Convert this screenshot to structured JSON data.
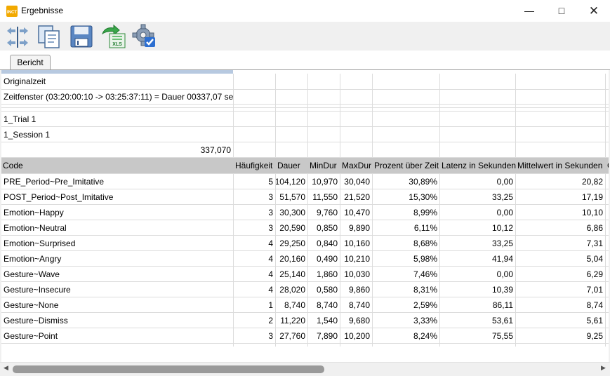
{
  "window": {
    "title": "Ergebnisse",
    "icon_text": "INCT"
  },
  "toolbar": {
    "buttons": [
      "transfer-icon",
      "copy-icon",
      "save-icon",
      "export-xls-icon",
      "settings-icon"
    ],
    "xls_label": "XLS"
  },
  "tabs": [
    {
      "label": "Bericht",
      "active": true
    }
  ],
  "report": {
    "info_rows": [
      "Originalzeit",
      "Zeitfenster  (03:20:00:10 -> 03:25:37:11) = Dauer 00337,07 sec",
      "1_Trial 1",
      "1_Session 1"
    ],
    "total": "337,070",
    "columns": [
      "Code",
      "Häufigkeit",
      "Dauer",
      "MinDur",
      "MaxDur",
      "Prozent über Zeit",
      "Latenz in Sekunden",
      "Mittelwert in Sekunden",
      "C"
    ],
    "rows": [
      [
        "PRE_Period~Pre_Imitative",
        "5",
        "104,120",
        "10,970",
        "30,040",
        "30,89%",
        "0,00",
        "20,82"
      ],
      [
        "POST_Period~Post_Imitative",
        "3",
        "51,570",
        "11,550",
        "21,520",
        "15,30%",
        "33,25",
        "17,19"
      ],
      [
        "Emotion~Happy",
        "3",
        "30,300",
        "9,760",
        "10,470",
        "8,99%",
        "0,00",
        "10,10"
      ],
      [
        "Emotion~Neutral",
        "3",
        "20,590",
        "0,850",
        "9,890",
        "6,11%",
        "10,12",
        "6,86"
      ],
      [
        "Emotion~Surprised",
        "4",
        "29,250",
        "0,840",
        "10,160",
        "8,68%",
        "33,25",
        "7,31"
      ],
      [
        "Emotion~Angry",
        "4",
        "20,160",
        "0,490",
        "10,210",
        "5,98%",
        "41,94",
        "5,04"
      ],
      [
        "Gesture~Wave",
        "4",
        "25,140",
        "1,860",
        "10,030",
        "7,46%",
        "0,00",
        "6,29"
      ],
      [
        "Gesture~Insecure",
        "4",
        "28,020",
        "0,580",
        "9,860",
        "8,31%",
        "10,39",
        "7,01"
      ],
      [
        "Gesture~None",
        "1",
        "8,740",
        "8,740",
        "8,740",
        "2,59%",
        "86,11",
        "8,74"
      ],
      [
        "Gesture~Dismiss",
        "2",
        "11,220",
        "1,540",
        "9,680",
        "3,33%",
        "53,61",
        "5,61"
      ],
      [
        "Gesture~Point",
        "3",
        "27,760",
        "7,890",
        "10,200",
        "8,24%",
        "75,55",
        "9,25"
      ]
    ]
  }
}
